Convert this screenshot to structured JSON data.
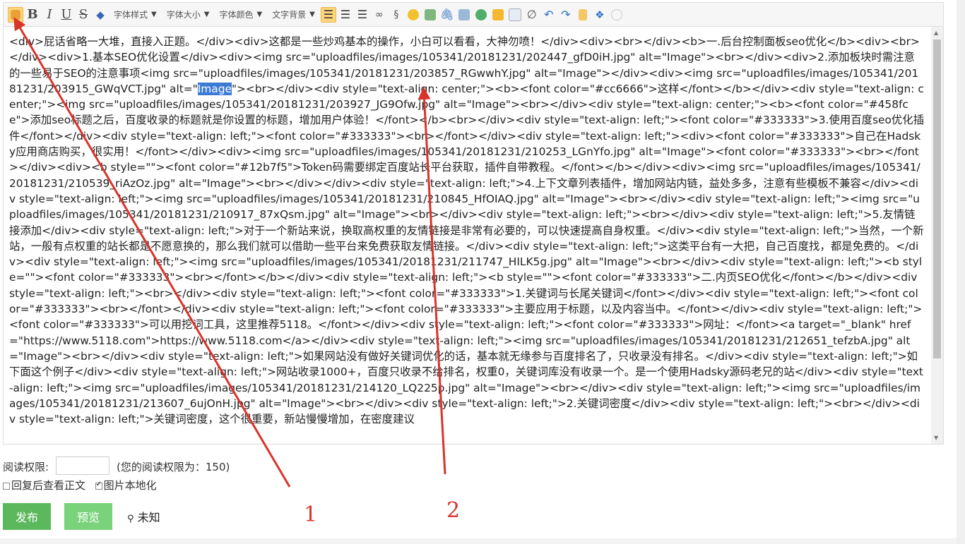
{
  "toolbar": {
    "font_style": "字体样式",
    "font_size": "字体大小",
    "font_color": "字体颜色",
    "text_bg": "文字背景",
    "dropdown_arrow": "▼"
  },
  "editor": {
    "before_selection": "<div>屁话省略一大堆，直接入正题。</div><div>这都是一些炒鸡基本的操作，小白可以看看，大神勿喷！</div><div><br></div><b>一.后台控制面板seo优化</b><div><br></div><div>1.基本SEO优化设置</div><div><img src=\"uploadfiles/images/105341/20181231/202447_gfD0iH.jpg\" alt=\"Image\"><br></div><div>2.添加板块时需注意的一些易于SEO的注意事项<img src=\"uploadfiles/images/105341/20181231/203857_RGwwhY.jpg\" alt=\"Image\"></div><div><img src=\"uploadfiles/images/105341/20181231/203915_GWqVCT.jpg\" alt=\"",
    "selected": "Image",
    "after_selection": "\"><br></div><div style=\"text-align: center;\"><b><font color=\"#cc6666\">这样</font></b></div><div style=\"text-align: center;\"><img src=\"uploadfiles/images/105341/20181231/203927_JG9Ofw.jpg\" alt=\"Image\"><br></div><div style=\"text-align: center;\"><b><font color=\"#458fce\">添加seo标题之后，百度收录的标题就是你设置的标题，增加用户体验！</font></b><br></div><div style=\"text-align: left;\"><font color=\"#333333\">3.使用百度seo优化插件</font></div><div style=\"text-align: left;\"><font color=\"#333333\"><br></font></div><div style=\"text-align: left;\"><div><font color=\"#333333\">自己在Hadsky应用商店购买，很实用！</font></div><div><img src=\"uploadfiles/images/105341/20181231/210253_LGnYfo.jpg\" alt=\"Image\"><font color=\"#333333\"><br></font></div><div><b style=\"\"><font color=\"#12b7f5\">Token码需要绑定百度站长平台获取，插件自带教程。</font></b></div><div><img src=\"uploadfiles/images/105341/20181231/210539_riAzOz.jpg\" alt=\"Image\"><br></div></div><div style=\"text-align: left;\">4.上下文章列表插件，增加网站内链，益处多多，注意有些模板不兼容</div><div style=\"text-align: left;\"><img src=\"uploadfiles/images/105341/20181231/210845_HfOIAQ.jpg\" alt=\"Image\"><br></div><div style=\"text-align: left;\"><img src=\"uploadfiles/images/105341/20181231/210917_87xQsm.jpg\" alt=\"Image\"><br></div><div style=\"text-align: left;\"><br></div><div style=\"text-align: left;\">5.友情链接添加</div><div style=\"text-align: left;\">对于一个新站来说，换取高权重的友情链接是非常有必要的，可以快速提高自身权重。</div><div style=\"text-align: left;\">当然，一个新站，一般有点权重的站长都是不愿意换的，那么我们就可以借助一些平台来免费获取友情链接。</div><div style=\"text-align: left;\">这类平台有一大把，自己百度找，都是免费的。</div><div style=\"text-align: left;\"><img src=\"uploadfiles/images/105341/20181231/211747_HILK5g.jpg\" alt=\"Image\"><br></div><div style=\"text-align: left;\"><b style=\"\"><font color=\"#333333\"><br></font></b></div><div style=\"text-align: left;\"><b style=\"\"><font color=\"#333333\">二.内页SEO优化</font></b></div><div style=\"text-align: left;\"><br></div><div style=\"text-align: left;\"><font color=\"#333333\">1.关键词与长尾关键词</font></div><div style=\"text-align: left;\"><font color=\"#333333\"><br></font></div><div style=\"text-align: left;\"><font color=\"#333333\">主要应用于标题，以及内容当中。</font></div><div style=\"text-align: left;\"><font color=\"#333333\">可以用挖词工具，这里推荐5118。</font></div><div style=\"text-align: left;\"><font color=\"#333333\">网址：</font><a target=\"_blank\" href=\"https://www.5118.com\">https://www.5118.com</a></div><div style=\"text-align: left;\"><img src=\"uploadfiles/images/105341/20181231/212651_tefzbA.jpg\" alt=\"Image\"><br></div><div style=\"text-align: left;\">如果网站没有做好关键词优化的话，基本就无缘参与百度排名了，只收录没有排名。</div><div style=\"text-align: left;\">如下面这个例子</div><div style=\"text-align: left;\">网站收录1000+，百度只收录不给排名，权重0，关键词库没有收录一个。是一个使用Hadsky源码老兄的站</div><div style=\"text-align: left;\"><img src=\"uploadfiles/images/105341/20181231/214120_LQ225p.jpg\" alt=\"Image\"><br></div><div style=\"text-align: left;\"><img src=\"uploadfiles/images/105341/20181231/213607_6ujOnH.jpg\" alt=\"Image\"><br></div><div style=\"text-align: left;\">2.关键词密度</div><div style=\"text-align: left;\"><br></div><div style=\"text-align: left;\">关键词密度，这个很重要，新站慢慢增加，在密度建议"
  },
  "form": {
    "permission_label": "阅读权限:",
    "permission_value": "",
    "permission_hint": "(您的阅读权限为：150)",
    "reply_view_label": "回复后查看正文",
    "reply_view_checked": false,
    "localize_images_label": "图片本地化",
    "localize_images_checked": true
  },
  "actions": {
    "publish": "发布",
    "preview": "预览",
    "location": "未知"
  },
  "annotations": {
    "label_1": "1",
    "label_2": "2",
    "color": "#d9332b"
  },
  "colors": {
    "publish_bg": "#5cb85c",
    "preview_bg": "#7ad37a",
    "selection_bg": "#3c7bd4",
    "active_tool_bg": "#ffd57a"
  }
}
